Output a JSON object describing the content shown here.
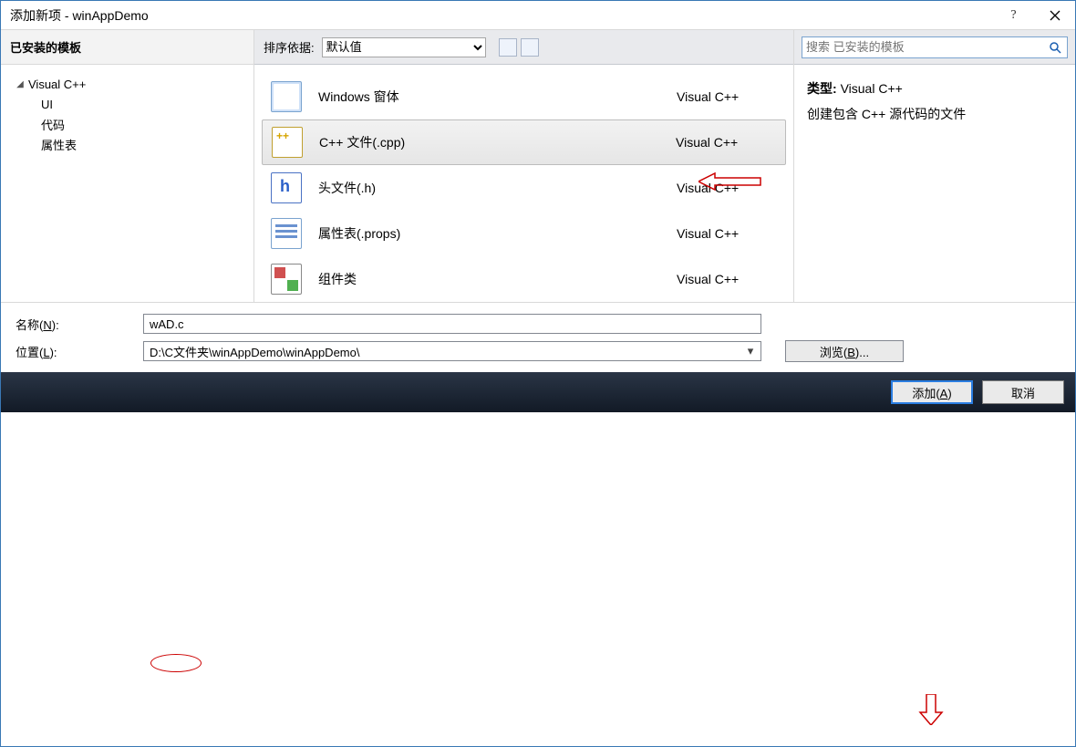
{
  "window": {
    "title": "添加新项 - winAppDemo"
  },
  "sidebar": {
    "header": "已安装的模板",
    "root": "Visual C++",
    "children": [
      "UI",
      "代码",
      "属性表"
    ]
  },
  "toolbar": {
    "sort_label": "排序依据:",
    "sort_value": "默认值"
  },
  "search": {
    "placeholder": "搜索 已安装的模板"
  },
  "templates": [
    {
      "name": "Windows 窗体",
      "category": "Visual C++",
      "iconClass": "icon-doc"
    },
    {
      "name": "C++ 文件(.cpp)",
      "category": "Visual C++",
      "iconClass": "icon-cpp",
      "selected": true
    },
    {
      "name": "头文件(.h)",
      "category": "Visual C++",
      "iconClass": "icon-h"
    },
    {
      "name": "属性表(.props)",
      "category": "Visual C++",
      "iconClass": "icon-props"
    },
    {
      "name": "组件类",
      "category": "Visual C++",
      "iconClass": "icon-comp"
    }
  ],
  "details": {
    "type_label": "类型:",
    "type_value": "Visual C++",
    "description": "创建包含 C++ 源代码的文件"
  },
  "form": {
    "name_label_pre": "名称(",
    "name_label_u": "N",
    "name_label_post": "):",
    "name_value": "wAD.c",
    "location_label_pre": "位置(",
    "location_label_u": "L",
    "location_label_post": "):",
    "location_value": "D:\\C文件夹\\winAppDemo\\winAppDemo\\",
    "browse_pre": "浏览(",
    "browse_u": "B",
    "browse_post": ")..."
  },
  "buttons": {
    "add_pre": "添加(",
    "add_u": "A",
    "add_post": ")",
    "cancel": "取消"
  }
}
